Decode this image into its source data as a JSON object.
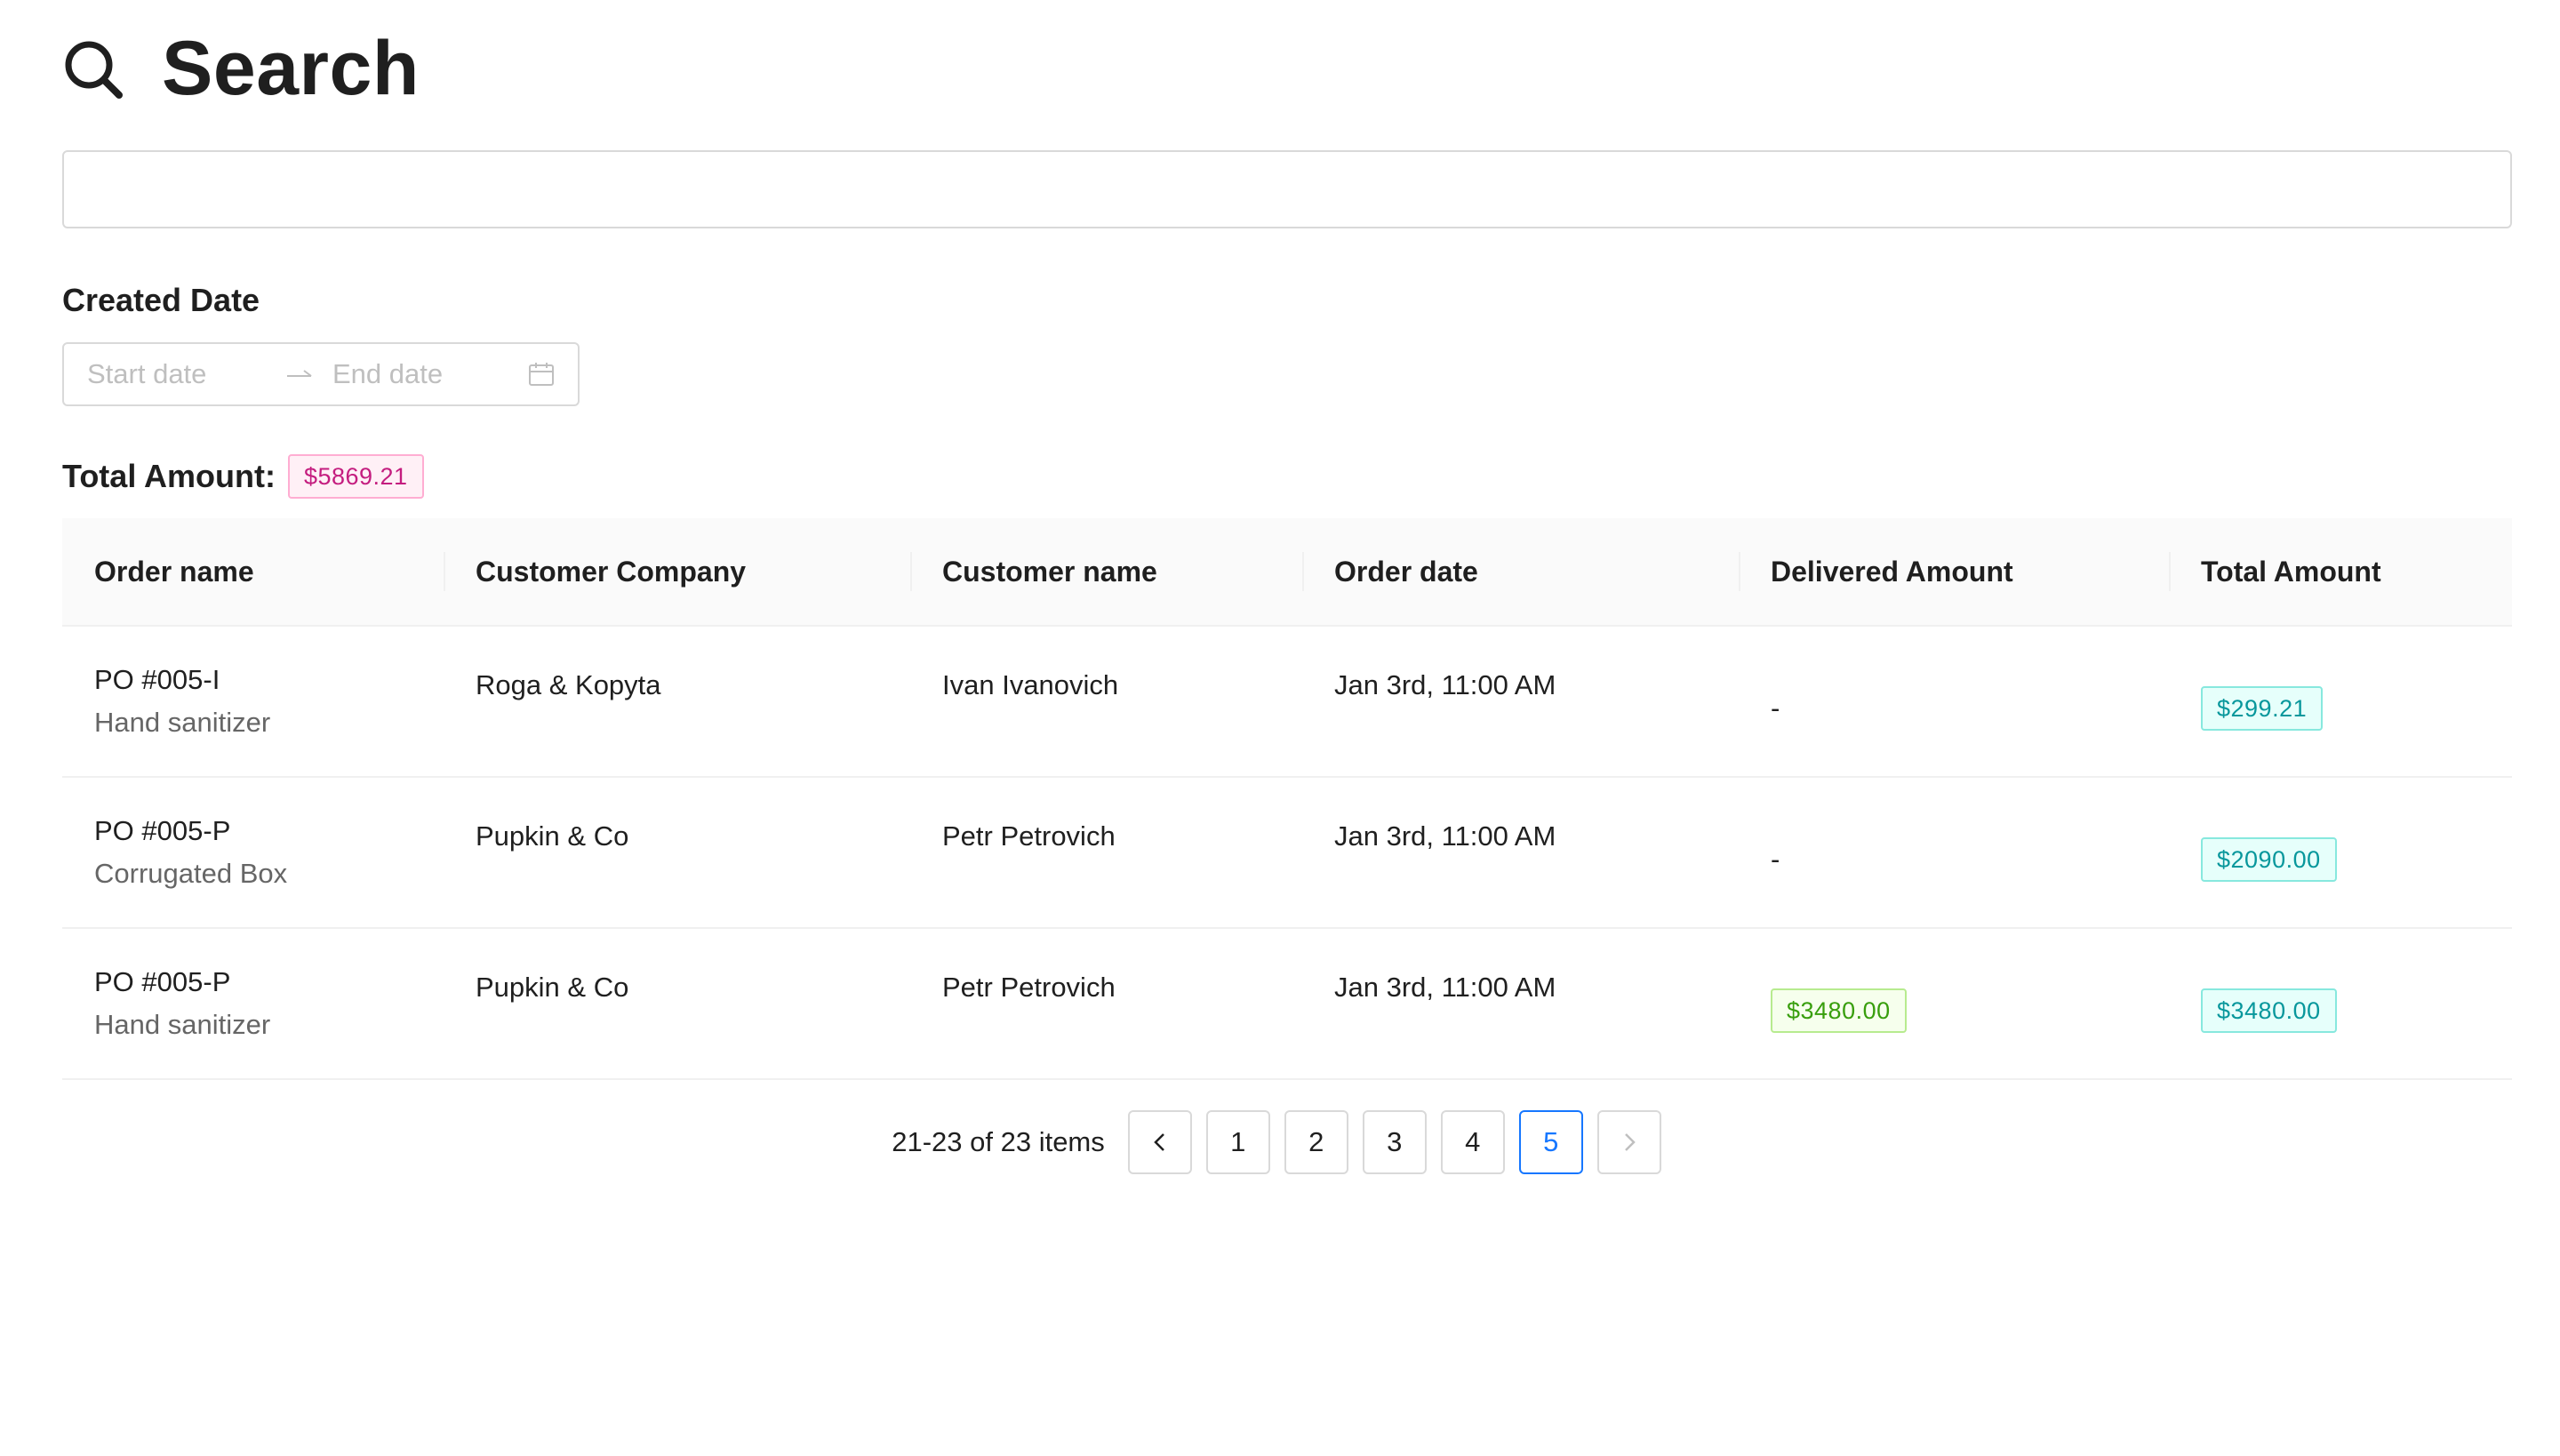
{
  "header": {
    "title": "Search",
    "icon": "search-icon"
  },
  "search": {
    "value": "",
    "placeholder": ""
  },
  "filters": {
    "created_date_label": "Created Date",
    "start_placeholder": "Start date",
    "end_placeholder": "End date"
  },
  "total": {
    "label": "Total Amount:",
    "value": "$5869.21"
  },
  "table": {
    "columns": [
      "Order name",
      "Customer Company",
      "Customer name",
      "Order date",
      "Delivered Amount",
      "Total Amount"
    ],
    "rows": [
      {
        "order": "PO #005-I",
        "product": "Hand sanitizer",
        "company": "Roga & Kopyta",
        "customer": "Ivan Ivanovich",
        "date": "Jan 3rd, 11:00 AM",
        "delivered": "-",
        "total": "$299.21"
      },
      {
        "order": "PO #005-P",
        "product": "Corrugated Box",
        "company": "Pupkin & Co",
        "customer": "Petr Petrovich",
        "date": "Jan 3rd, 11:00 AM",
        "delivered": "-",
        "total": "$2090.00"
      },
      {
        "order": "PO #005-P",
        "product": "Hand sanitizer",
        "company": "Pupkin & Co",
        "customer": "Petr Petrovich",
        "date": "Jan 3rd, 11:00 AM",
        "delivered": "$3480.00",
        "total": "$3480.00"
      }
    ]
  },
  "pagination": {
    "summary": "21-23 of 23 items",
    "pages": [
      "1",
      "2",
      "3",
      "4",
      "5"
    ],
    "current": "5",
    "prev": "<",
    "next": ">"
  },
  "colors": {
    "primary": "#1677ff",
    "tag_magenta": "#c41d7f",
    "tag_cyan": "#08979c",
    "tag_green": "#389e0d"
  }
}
